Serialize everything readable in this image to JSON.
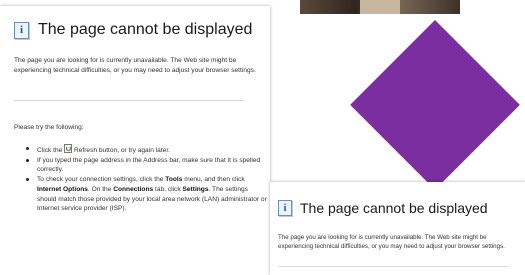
{
  "panels": [
    {
      "title": "The page cannot be displayed",
      "icon": "info-icon",
      "intro": "The page you are looking for is currently unavailable. The Web site might be experiencing technical difficulties, or you may need to adjust your browser settings.",
      "try_heading": "Please try the following:",
      "bullets": [
        {
          "parts": [
            {
              "text": "Click the "
            },
            {
              "icon": "refresh-icon"
            },
            {
              "text": " Refresh button, or try again later."
            }
          ]
        },
        {
          "parts": [
            {
              "text": "If you typed the page address in the Address bar, make sure that it is spelled correctly."
            }
          ]
        },
        {
          "parts": [
            {
              "text": "To check your connection settings, click the "
            },
            {
              "bold": "Tools"
            },
            {
              "text": " menu, and then click "
            },
            {
              "bold": "Internet Options"
            },
            {
              "text": ". On the "
            },
            {
              "bold": "Connections"
            },
            {
              "text": " tab, click "
            },
            {
              "bold": "Settings"
            },
            {
              "text": ". The settings should match those provided by your local area network (LAN) administrator or Internet service provider (ISP)."
            }
          ]
        }
      ]
    },
    {
      "title": "The page cannot be displayed",
      "icon": "info-icon",
      "intro": "The page you are looking for is currently unavailable. The Web site might be experiencing technical difficulties, or you may need to adjust your browser settings."
    }
  ],
  "colors": {
    "diamond": "#7a2ea0",
    "icon_border": "#6b8fc4",
    "icon_text": "#1f4fa3"
  }
}
